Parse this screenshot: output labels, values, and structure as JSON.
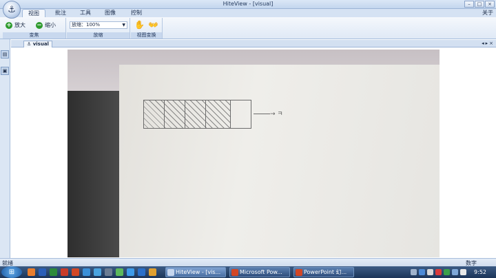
{
  "window": {
    "title": "HiteView - [visual]",
    "about_label": "关于",
    "controls": {
      "minimize": "–",
      "restore": "□",
      "close": "×"
    }
  },
  "ribbon": {
    "tabs": [
      {
        "label": "视图",
        "active": true
      },
      {
        "label": "批注",
        "active": false
      },
      {
        "label": "工具",
        "active": false
      },
      {
        "label": "图像",
        "active": false
      },
      {
        "label": "控制",
        "active": false
      }
    ],
    "groups": {
      "transform": {
        "label": "变焦",
        "zoom_in": "放大",
        "zoom_out": "缩小"
      },
      "zoom": {
        "label": "放缩",
        "combo_value": "放缩：100%"
      },
      "view_transform": {
        "label": "视图变换"
      }
    }
  },
  "document": {
    "tab_label": "visual",
    "arrow_text": "→ ㅋ"
  },
  "status": {
    "left": "就绪",
    "right": "数字"
  },
  "taskbar": {
    "tasks": [
      {
        "label": "HiteView - [vis...",
        "active": true
      },
      {
        "label": "Microsoft Pow...",
        "active": false
      },
      {
        "label": "PowerPoint 幻...",
        "active": false
      }
    ],
    "clock": "9:52"
  }
}
